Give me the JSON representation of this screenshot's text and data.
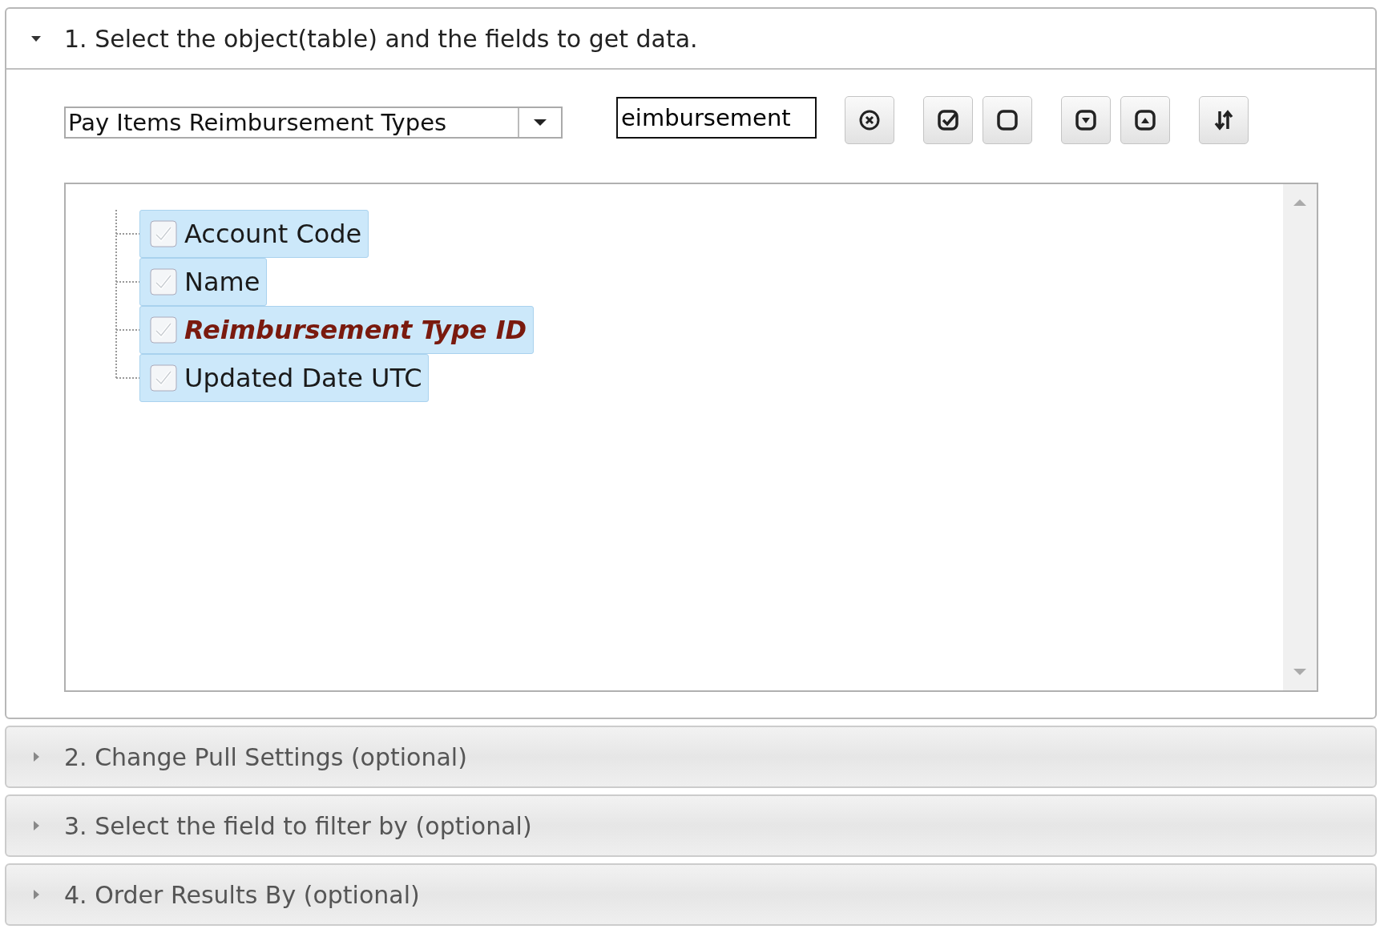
{
  "sections": [
    {
      "title": "1. Select the object(table) and the fields to get data.",
      "expanded": true,
      "object_select": {
        "value": "Pay Items Reimbursement Types"
      },
      "search": {
        "value": "eimbursement"
      },
      "toolbar": [
        {
          "kind": "clear"
        },
        {
          "kind": "check-all"
        },
        {
          "kind": "uncheck-all"
        },
        {
          "kind": "expand-all"
        },
        {
          "kind": "collapse-all"
        },
        {
          "kind": "sort"
        }
      ],
      "fields": [
        {
          "label": "Account Code",
          "checked": true,
          "selected": true,
          "match": false
        },
        {
          "label": "Name",
          "checked": true,
          "selected": true,
          "match": false
        },
        {
          "label": "Reimbursement Type ID",
          "checked": true,
          "selected": true,
          "match": true
        },
        {
          "label": "Updated Date UTC",
          "checked": true,
          "selected": true,
          "match": false
        }
      ]
    },
    {
      "title": "2. Change Pull Settings (optional)",
      "expanded": false
    },
    {
      "title": "3. Select the field to filter by (optional)",
      "expanded": false
    },
    {
      "title": "4. Order Results By (optional)",
      "expanded": false
    }
  ]
}
